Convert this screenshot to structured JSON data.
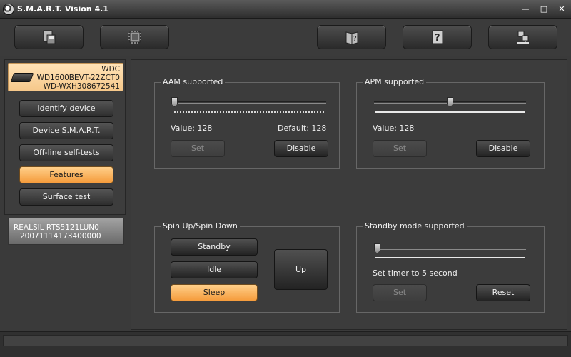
{
  "window": {
    "title": "S.M.A.R.T. Vision 4.1",
    "controls": {
      "minimize": "—",
      "maximize": "□",
      "close": "✕"
    }
  },
  "toolbar": {
    "buttons": [
      {
        "icon": "save-drive-icon"
      },
      {
        "icon": "chip-icon"
      },
      {
        "icon": "book-help-icon"
      },
      {
        "icon": "question-icon"
      },
      {
        "icon": "network-icon"
      }
    ]
  },
  "sidebar": {
    "device": {
      "line1": "WDC",
      "line2": "WD1600BEVT-22ZCT0",
      "line3": "WD-WXH308672541"
    },
    "nav": {
      "identify": "Identify device",
      "smart": "Device S.M.A.R.T.",
      "offline": "Off-line self-tests",
      "features": "Features",
      "surface": "Surface test"
    },
    "device2": {
      "line1": "REALSIL RTS5121LUN0",
      "line2": "20071114173400000"
    }
  },
  "aam": {
    "legend": "AAM supported",
    "value_label": "Value: 128",
    "default_label": "Default: 128",
    "slider_value": 128,
    "set": "Set",
    "disable": "Disable"
  },
  "apm": {
    "legend": "APM supported",
    "value_label": "Value: 128",
    "slider_value": 128,
    "set": "Set",
    "disable": "Disable"
  },
  "spin": {
    "legend": "Spin Up/Spin Down",
    "standby": "Standby",
    "idle": "Idle",
    "sleep": "Sleep",
    "up": "Up"
  },
  "standby_mode": {
    "legend": "Standby mode supported",
    "timer_label": "Set timer to 5 second",
    "set": "Set",
    "reset": "Reset"
  },
  "colors": {
    "accent_orange": "#f59c3c",
    "background": "#3c3c3c"
  }
}
